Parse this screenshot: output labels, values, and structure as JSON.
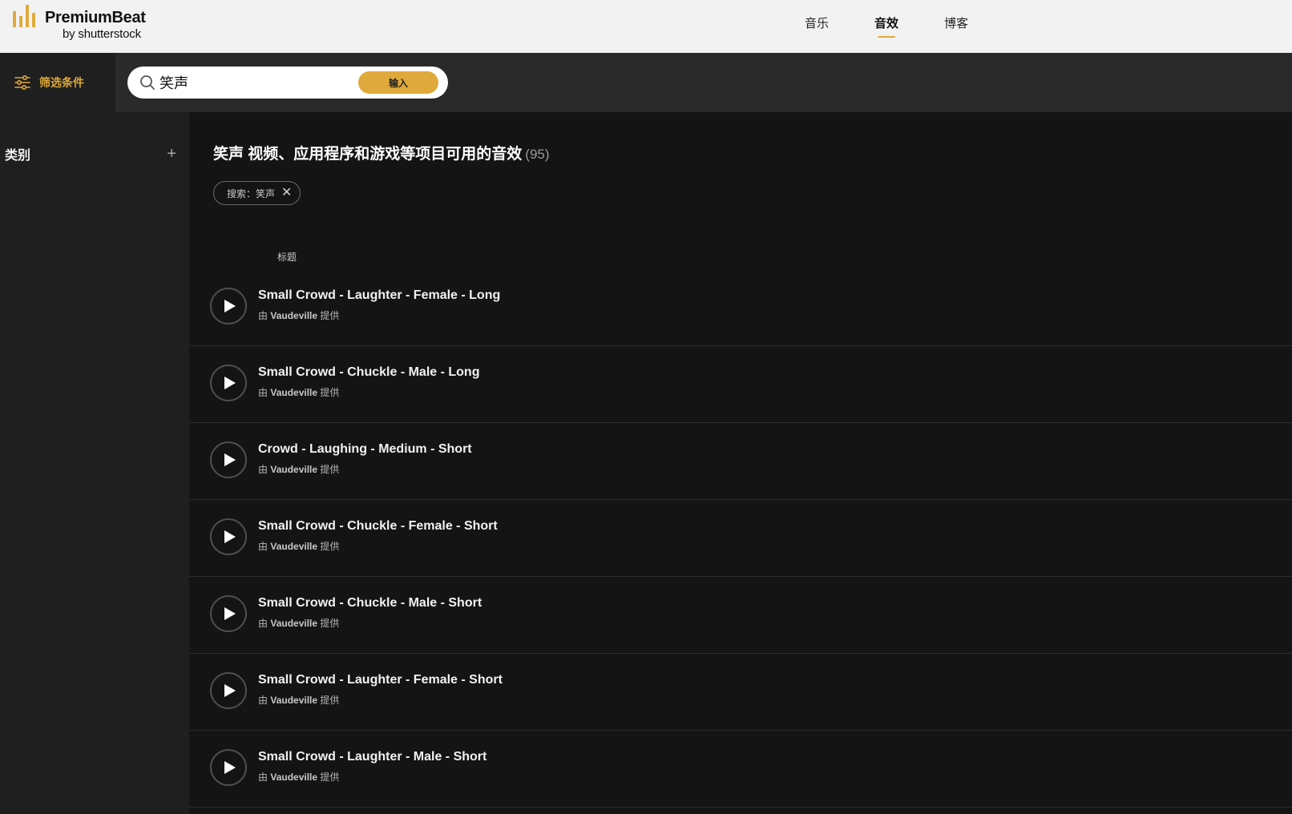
{
  "brand": {
    "primary": "PremiumBeat",
    "secondary": "by shutterstock",
    "accent_color": "#e0a93b"
  },
  "nav": {
    "items": [
      {
        "label": "音乐",
        "active": false
      },
      {
        "label": "音效",
        "active": true
      },
      {
        "label": "博客",
        "active": false
      }
    ]
  },
  "search": {
    "filter_label": "筛选条件",
    "filter_icon": "sliders-icon",
    "search_icon": "search-icon",
    "value": "笑声",
    "submit_label": "输入"
  },
  "sidebar": {
    "category_title": "类别",
    "expand_symbol": "+"
  },
  "results": {
    "heading": "笑声 视频、应用程序和游戏等项目可用的音效",
    "count": "(95)",
    "chip_label": "搜索：笑声",
    "chip_close_symbol": "✕",
    "column_title": "标题",
    "rows": [
      {
        "title": "Small Crowd - Laughter - Female - Long",
        "prefix": "由",
        "artist": "Vaudeville",
        "suffix": "提供"
      },
      {
        "title": "Small Crowd - Chuckle - Male - Long",
        "prefix": "由",
        "artist": "Vaudeville",
        "suffix": "提供"
      },
      {
        "title": "Crowd - Laughing - Medium - Short",
        "prefix": "由",
        "artist": "Vaudeville",
        "suffix": "提供"
      },
      {
        "title": "Small Crowd - Chuckle - Female - Short",
        "prefix": "由",
        "artist": "Vaudeville",
        "suffix": "提供"
      },
      {
        "title": "Small Crowd - Chuckle - Male - Short",
        "prefix": "由",
        "artist": "Vaudeville",
        "suffix": "提供"
      },
      {
        "title": "Small Crowd - Laughter - Female - Short",
        "prefix": "由",
        "artist": "Vaudeville",
        "suffix": "提供"
      },
      {
        "title": "Small Crowd - Laughter - Male - Short",
        "prefix": "由",
        "artist": "Vaudeville",
        "suffix": "提供"
      }
    ]
  }
}
